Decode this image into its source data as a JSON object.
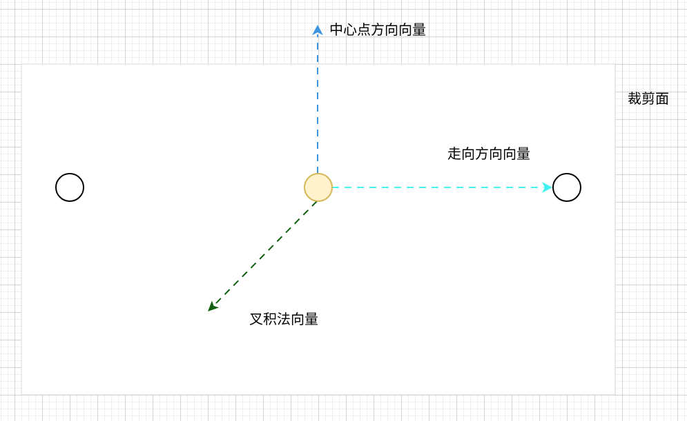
{
  "labels": {
    "center_direction_vector": "中心点方向向量",
    "walking_direction_vector": "走向方向向量",
    "cross_product_normal_vector": "叉积法向量",
    "clipping_plane": "裁剪面"
  },
  "colors": {
    "center_direction_arrow": "#3d95e0",
    "walking_direction_arrow": "#44f1f1",
    "cross_product_arrow": "#116011",
    "center_node_fill": "#fff2cc",
    "center_node_stroke": "#d6b656",
    "node_stroke": "#000000",
    "clipping_plane_fill": "#ffffff",
    "clipping_plane_stroke": "#d9d9d9"
  }
}
